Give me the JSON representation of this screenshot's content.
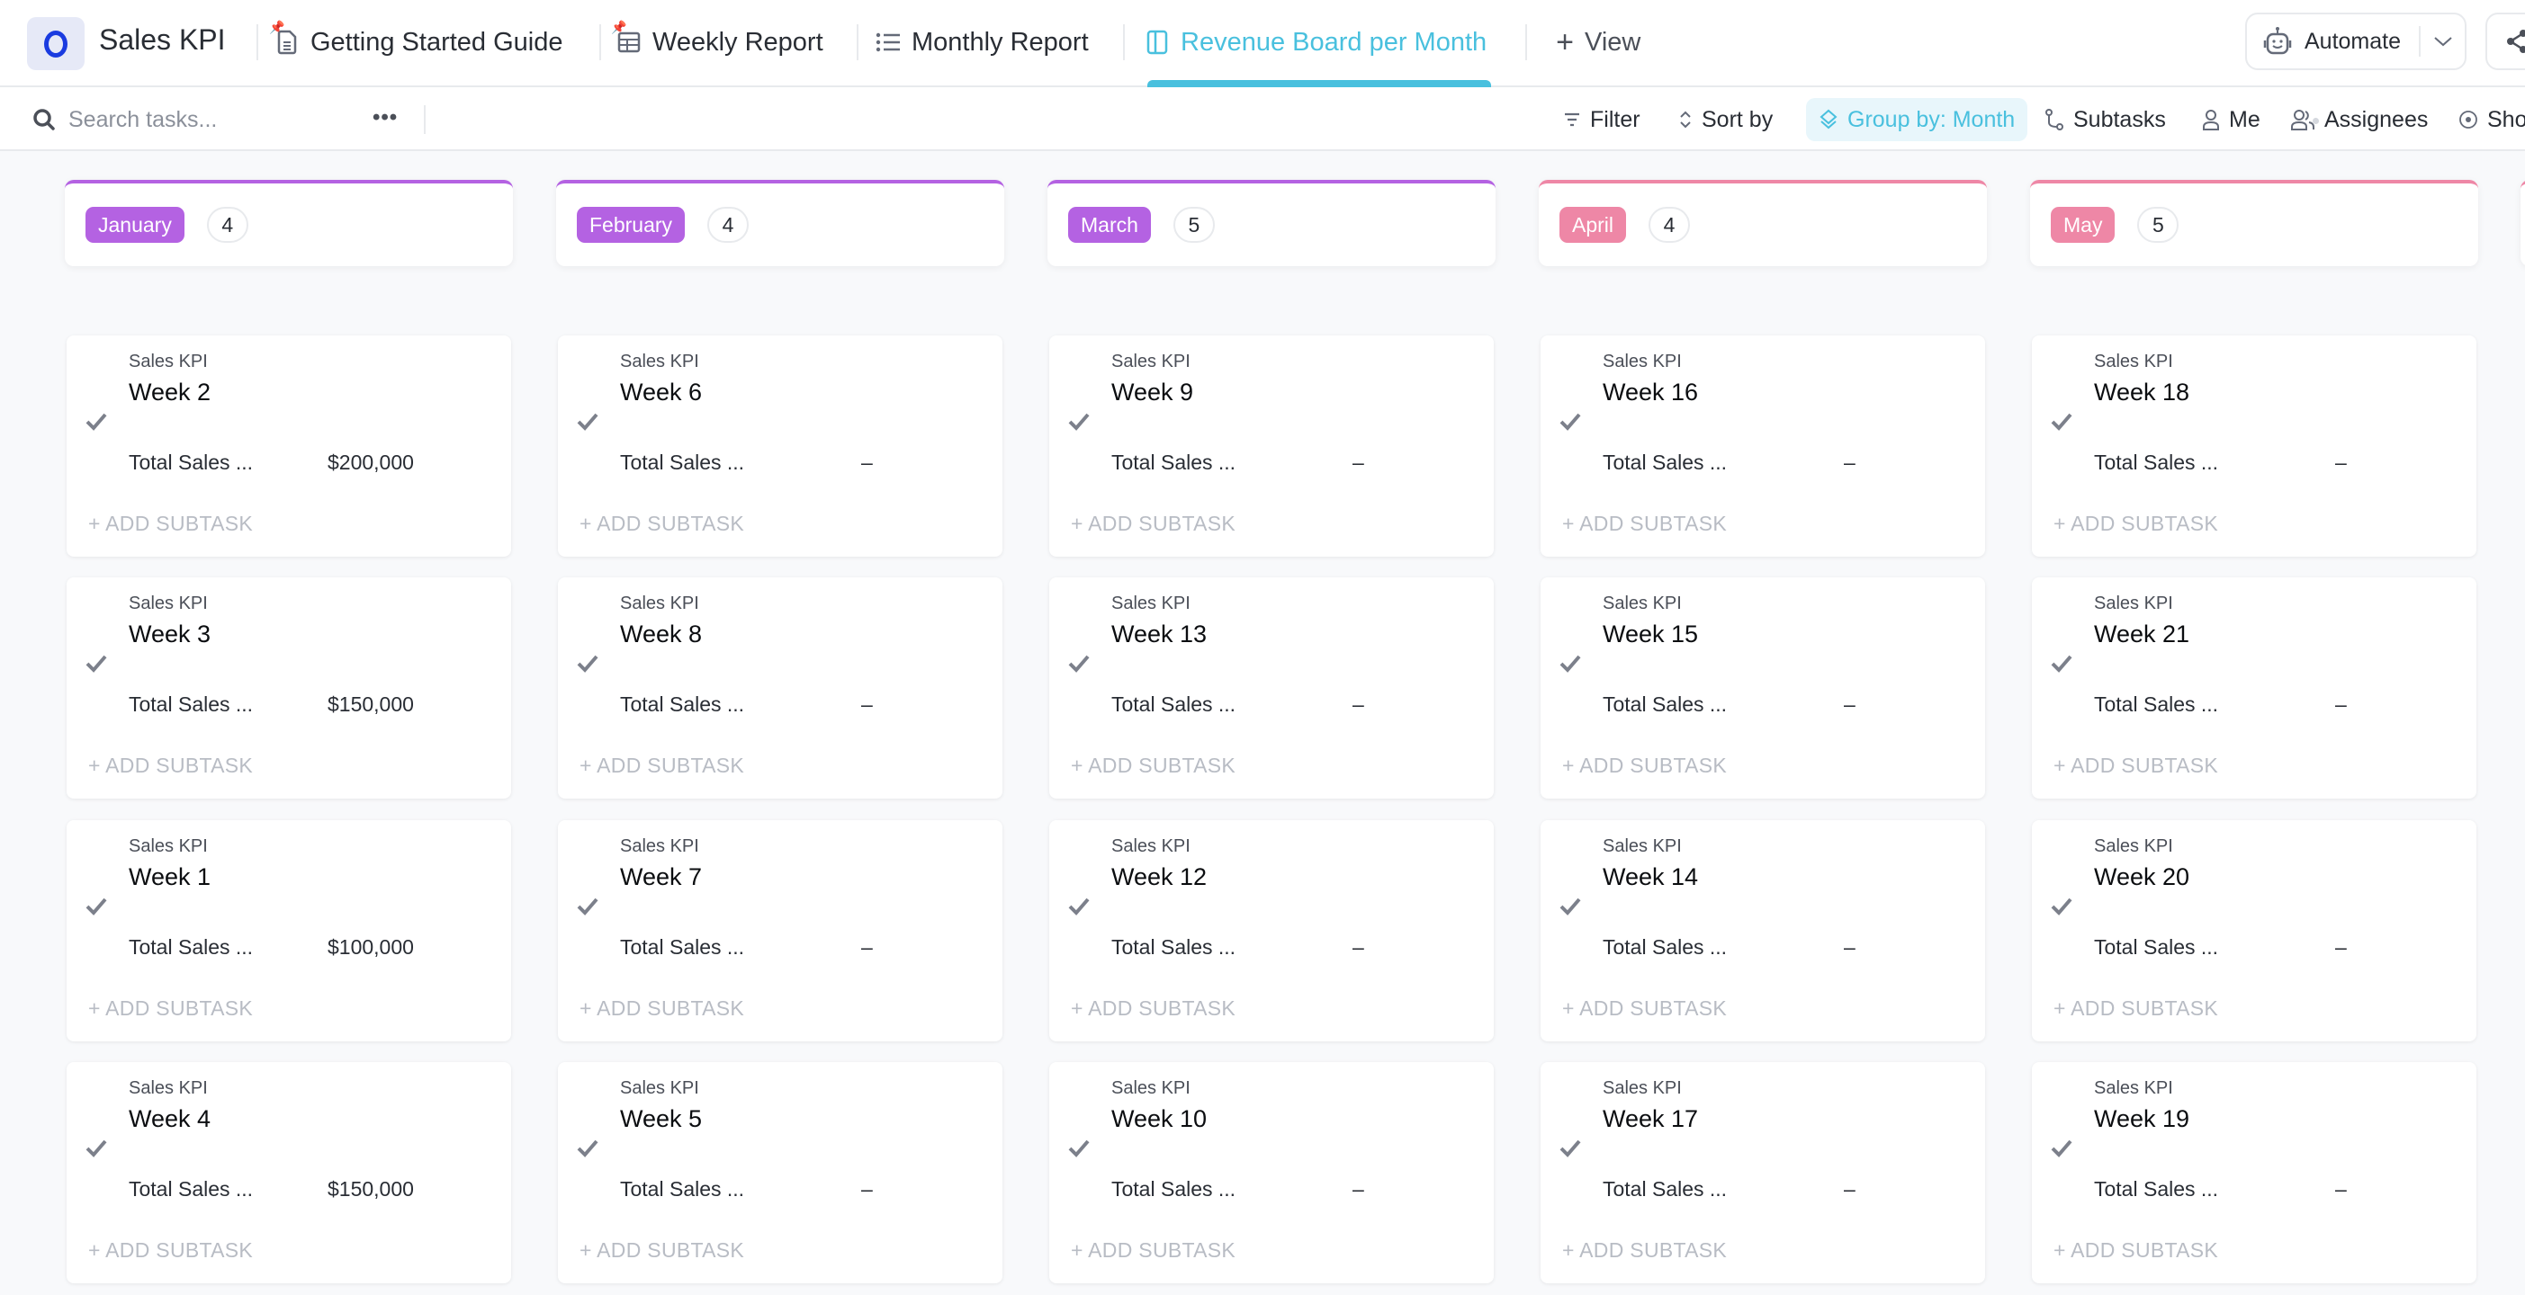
{
  "header": {
    "space_title": "Sales KPI",
    "tabs": [
      {
        "label": "Getting Started Guide",
        "icon": "doc-icon",
        "pinned": true
      },
      {
        "label": "Weekly Report",
        "icon": "table-icon",
        "pinned": true
      },
      {
        "label": "Monthly Report",
        "icon": "list-icon",
        "pinned": false
      },
      {
        "label": "Revenue Board per Month",
        "icon": "board-icon",
        "pinned": false,
        "active": true
      }
    ],
    "add_view_label": "View",
    "automate_label": "Automate",
    "accent_color": "#49c0de"
  },
  "toolbar": {
    "search_placeholder": "Search tasks...",
    "filter_label": "Filter",
    "sort_label": "Sort by",
    "group_label": "Group by: Month",
    "subtasks_label": "Subtasks",
    "me_label": "Me",
    "assignees_label": "Assignees",
    "show_label": "Sho"
  },
  "board": {
    "list_name": "Sales KPI",
    "field_label": "Total Sales ...",
    "add_subtask_label": "+ ADD SUBTASK",
    "columns": [
      {
        "month": "January",
        "count": "4",
        "color": "#b462e2",
        "cards": [
          {
            "title": "Week 2",
            "value": "$200,000"
          },
          {
            "title": "Week 3",
            "value": "$150,000"
          },
          {
            "title": "Week 1",
            "value": "$100,000"
          },
          {
            "title": "Week 4",
            "value": "$150,000"
          }
        ]
      },
      {
        "month": "February",
        "count": "4",
        "color": "#b462e2",
        "cards": [
          {
            "title": "Week 6",
            "value": "–"
          },
          {
            "title": "Week 8",
            "value": "–"
          },
          {
            "title": "Week 7",
            "value": "–"
          },
          {
            "title": "Week 5",
            "value": "–"
          }
        ]
      },
      {
        "month": "March",
        "count": "5",
        "color": "#b462e2",
        "cards": [
          {
            "title": "Week 9",
            "value": "–"
          },
          {
            "title": "Week 13",
            "value": "–"
          },
          {
            "title": "Week 12",
            "value": "–"
          },
          {
            "title": "Week 10",
            "value": "–"
          }
        ]
      },
      {
        "month": "April",
        "count": "4",
        "color": "#ee87a6",
        "cards": [
          {
            "title": "Week 16",
            "value": "–"
          },
          {
            "title": "Week 15",
            "value": "–"
          },
          {
            "title": "Week 14",
            "value": "–"
          },
          {
            "title": "Week 17",
            "value": "–"
          }
        ]
      },
      {
        "month": "May",
        "count": "5",
        "color": "#ee87a6",
        "cards": [
          {
            "title": "Week 18",
            "value": "–"
          },
          {
            "title": "Week 21",
            "value": "–"
          },
          {
            "title": "Week 20",
            "value": "–"
          },
          {
            "title": "Week 19",
            "value": "–"
          }
        ]
      }
    ]
  }
}
